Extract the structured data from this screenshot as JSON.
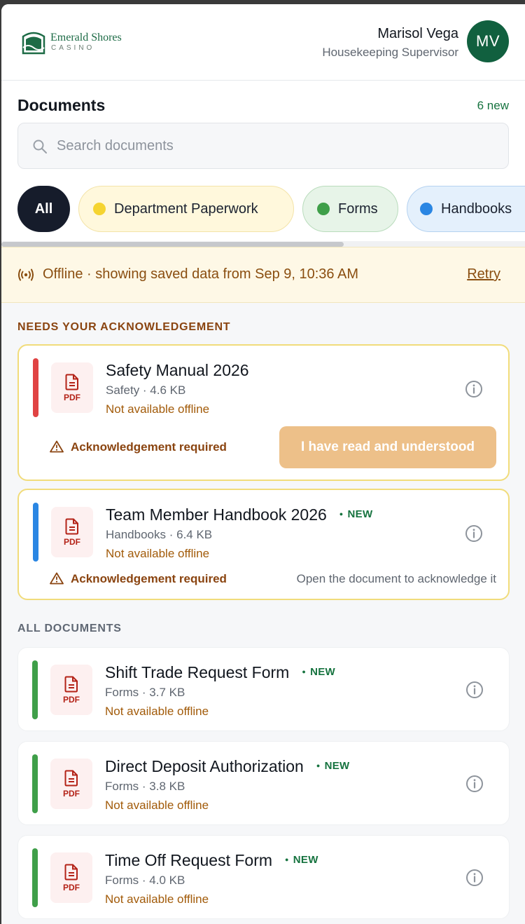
{
  "header": {
    "brand_name": "Emerald Shores",
    "brand_sub": "CASINO",
    "user_name": "Marisol Vega",
    "user_role": "Housekeeping Supervisor",
    "avatar_initials": "MV"
  },
  "documents": {
    "title": "Documents",
    "new_count": "6 new",
    "search_placeholder": "Search documents",
    "filters": [
      {
        "label": "All",
        "active": true
      },
      {
        "label": "Department Paperwork",
        "color": "#f5d431"
      },
      {
        "label": "Forms",
        "color": "#3f9f49"
      },
      {
        "label": "Handbooks",
        "color": "#2a86e3"
      }
    ]
  },
  "offline_banner": {
    "text": "Offline · showing saved data from Sep 9, 10:36 AM",
    "retry_label": "Retry"
  },
  "sections": {
    "ack_label": "NEEDS YOUR ACKNOWLEDGEMENT",
    "all_label": "ALL DOCUMENTS"
  },
  "ack_docs": [
    {
      "title": "Safety Manual 2026",
      "meta": "Safety · 4.6 KB",
      "offline": "Not available offline",
      "icon_label": "PDF",
      "stripe_color": "#e04343",
      "warning": "Acknowledgement required",
      "button_label": "I have read and understood"
    },
    {
      "title": "Team Member Handbook 2026",
      "badge": "NEW",
      "meta": "Handbooks · 6.4 KB",
      "offline": "Not available offline",
      "icon_label": "PDF",
      "stripe_color": "#2a86e3",
      "warning": "Acknowledgement required",
      "hint": "Open the document to acknowledge it"
    }
  ],
  "all_docs": [
    {
      "title": "Shift Trade Request Form",
      "badge": "NEW",
      "meta": "Forms · 3.7 KB",
      "offline": "Not available offline",
      "icon_label": "PDF",
      "stripe_color": "#3f9f49"
    },
    {
      "title": "Direct Deposit Authorization",
      "badge": "NEW",
      "meta": "Forms · 3.8 KB",
      "offline": "Not available offline",
      "icon_label": "PDF",
      "stripe_color": "#3f9f49"
    },
    {
      "title": "Time Off Request Form",
      "badge": "NEW",
      "meta": "Forms · 4.0 KB",
      "offline": "Not available offline",
      "icon_label": "PDF",
      "stripe_color": "#3f9f49"
    }
  ]
}
